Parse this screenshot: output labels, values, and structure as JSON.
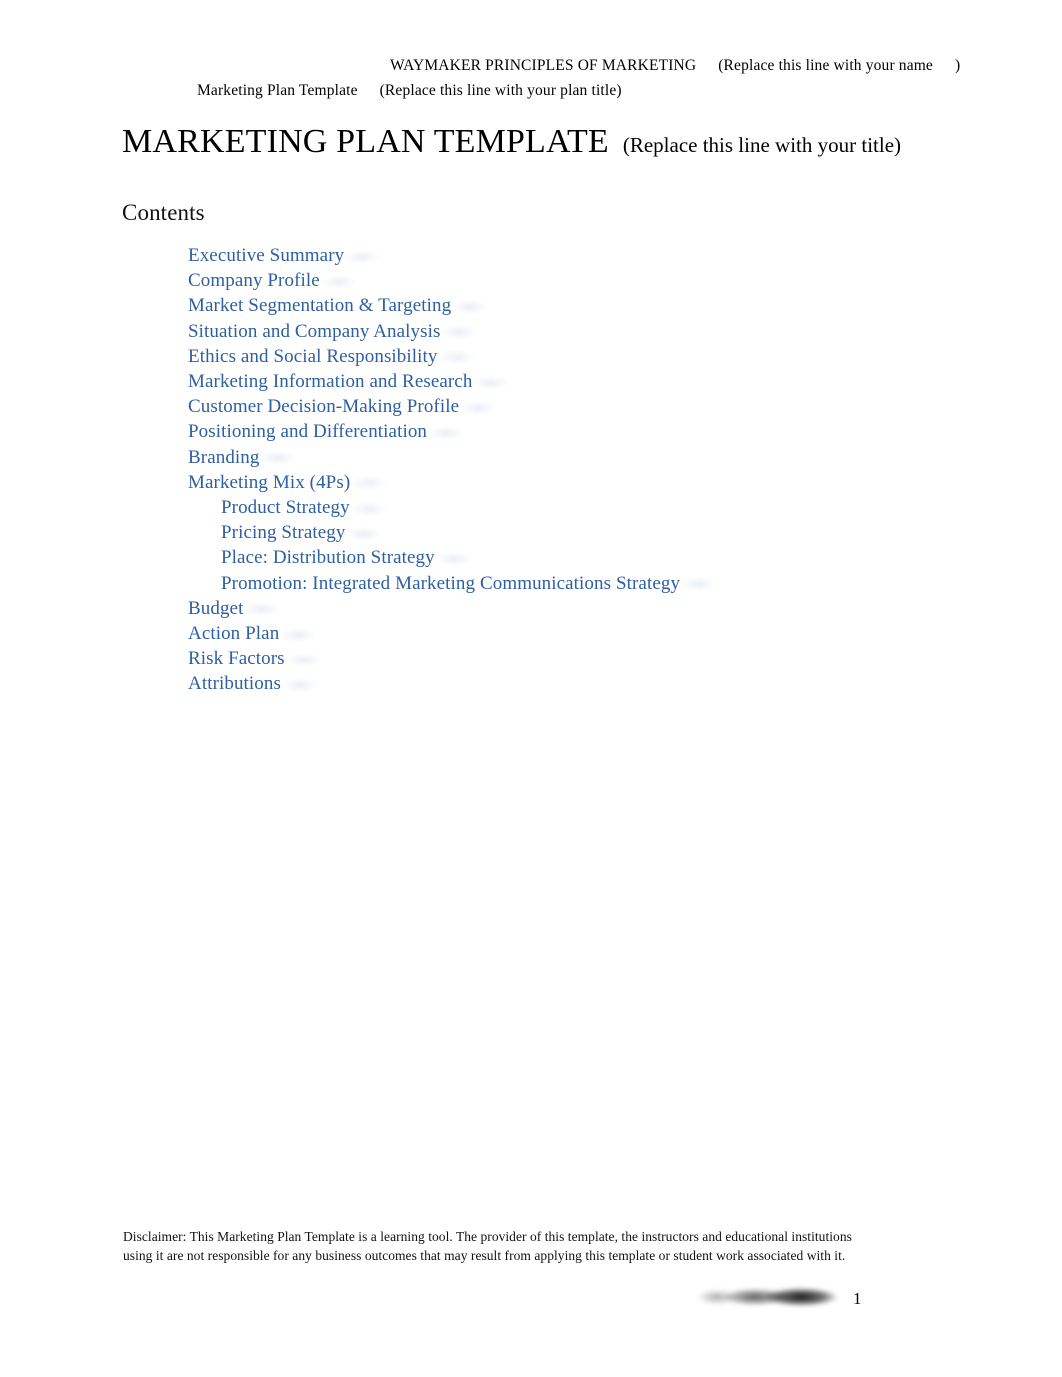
{
  "header": {
    "course_title": "WAYMAKER PRINCIPLES OF MARKETING",
    "name_placeholder": "(Replace this line with your name",
    "name_placeholder_close": ")",
    "doc_label": "Marketing Plan Template",
    "plan_title_placeholder": "(Replace this line with your plan title)"
  },
  "title": {
    "main": "MARKETING PLAN TEMPLATE",
    "sub": "(Replace this line with your title)"
  },
  "contents": {
    "heading": "Contents",
    "entries": [
      {
        "label": "Executive Summary",
        "level": 1
      },
      {
        "label": "Company Profile",
        "level": 1
      },
      {
        "label": "Market Segmentation & Targeting",
        "level": 1
      },
      {
        "label": "Situation and Company Analysis",
        "level": 1
      },
      {
        "label": "Ethics and Social Responsibility",
        "level": 1
      },
      {
        "label": "Marketing Information and Research",
        "level": 1
      },
      {
        "label": "Customer Decision-Making Profile",
        "level": 1
      },
      {
        "label": "Positioning and Differentiation",
        "level": 1
      },
      {
        "label": "Branding",
        "level": 1
      },
      {
        "label": "Marketing Mix (4Ps)",
        "level": 1
      },
      {
        "label": "Product Strategy",
        "level": 2
      },
      {
        "label": "Pricing Strategy",
        "level": 2
      },
      {
        "label": "Place: Distribution Strategy",
        "level": 2
      },
      {
        "label": "Promotion: Integrated Marketing Communications Strategy",
        "level": 2
      },
      {
        "label": "Budget",
        "level": 1
      },
      {
        "label": "Action Plan",
        "level": 1
      },
      {
        "label": "Risk Factors",
        "level": 1
      },
      {
        "label": "Attributions",
        "level": 1
      }
    ]
  },
  "disclaimer": {
    "text": "Disclaimer: This Marketing Plan Template is a learning tool. The provider of this template, the instructors and educational institutions using it are not responsible for any business outcomes that may result from applying this template or student work associated with it."
  },
  "footer": {
    "page_number": "1"
  },
  "colors": {
    "link_blue": "#2e5fa3",
    "body_text": "#111111",
    "page_background": "#ffffff"
  }
}
